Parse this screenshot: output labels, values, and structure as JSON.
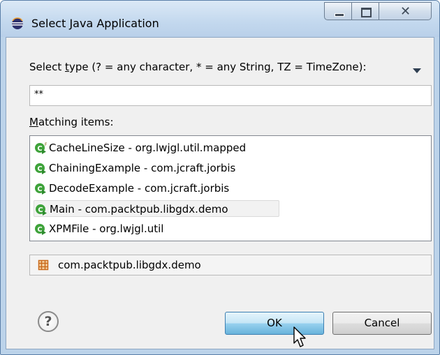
{
  "window": {
    "title": "Select Java Application",
    "title_icon": "eclipse-icon",
    "controls": [
      "minimize-icon",
      "maximize-icon",
      "close-icon"
    ]
  },
  "filter": {
    "label_prefix": "Select ",
    "label_mnemonic": "t",
    "label_rest": "ype (? = any character, * = any String, TZ = TimeZone):",
    "menu_icon": "triangle-down-icon",
    "value": "**"
  },
  "matching": {
    "label_mnemonic": "M",
    "label_rest": "atching items:",
    "items": [
      {
        "label": "CacheLineSize - org.lwjgl.util.mapped",
        "icon": "java-class-run-final-icon",
        "selected": false
      },
      {
        "label": "ChainingExample - com.jcraft.jorbis",
        "icon": "java-class-run-icon",
        "selected": false
      },
      {
        "label": "DecodeExample - com.jcraft.jorbis",
        "icon": "java-class-run-icon",
        "selected": false
      },
      {
        "label": "Main - com.packtpub.libgdx.demo",
        "icon": "java-class-run-icon",
        "selected": true
      },
      {
        "label": "XPMFile - org.lwjgl.util",
        "icon": "java-class-run-icon",
        "selected": false
      }
    ]
  },
  "status": {
    "icon": "package-icon",
    "text": "com.packtpub.libgdx.demo"
  },
  "buttons": {
    "help_icon": "help-icon",
    "ok": "OK",
    "cancel": "Cancel"
  },
  "colors": {
    "title_bar": "#c3d8ee",
    "ok_button": "#98d1ef",
    "class_icon": "#3fa33b",
    "package_icon": "#c96a1c"
  }
}
